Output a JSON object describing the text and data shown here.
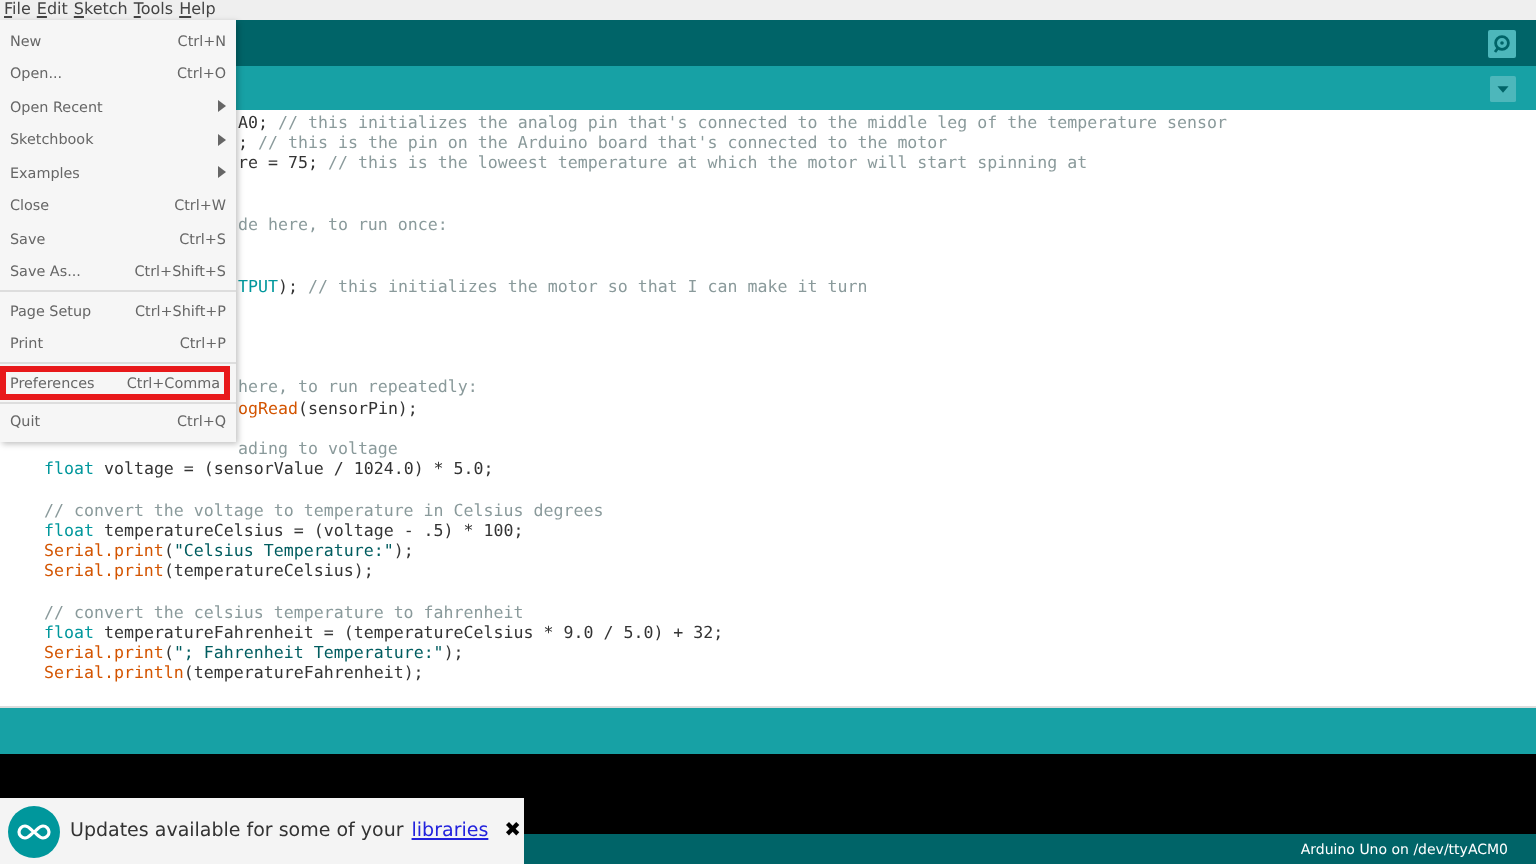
{
  "menubar": [
    "File",
    "Edit",
    "Sketch",
    "Tools",
    "Help"
  ],
  "editor": {
    "lines": [
      {
        "kind": "behind_menu",
        "segments": [
          {
            "text": "A0; ",
            "kind": "plain"
          },
          {
            "text": "// this initializes the analog pin that's connected to the middle leg of the temperature sensor",
            "kind": "comment"
          }
        ]
      },
      {
        "kind": "behind_menu",
        "segments": [
          {
            "text": "; ",
            "kind": "plain"
          },
          {
            "text": "// this is the pin on the Arduino board that's connected to the motor",
            "kind": "comment"
          }
        ]
      },
      {
        "kind": "behind_menu",
        "segments": [
          {
            "text": "re = 75; ",
            "kind": "plain"
          },
          {
            "text": "// this is the loweest temperature at which the motor will start spinning at",
            "kind": "comment"
          }
        ]
      },
      {
        "kind": "blank"
      },
      {
        "kind": "blank"
      },
      {
        "kind": "behind_menu",
        "segments": [
          {
            "text": "de here, to run once:",
            "kind": "comment"
          }
        ]
      },
      {
        "kind": "blank"
      },
      {
        "kind": "blank"
      },
      {
        "kind": "behind_menu",
        "segments": [
          {
            "text": "TPUT",
            "kind": "constant"
          },
          {
            "text": "); ",
            "kind": "plain"
          },
          {
            "text": "// this initializes the motor so that I can make it turn",
            "kind": "comment"
          }
        ]
      },
      {
        "kind": "blank"
      },
      {
        "kind": "blank"
      },
      {
        "kind": "blank"
      },
      {
        "kind": "blank"
      },
      {
        "kind": "behind_menu",
        "segments": [
          {
            "text": "here, to run repeatedly:",
            "kind": "comment"
          }
        ]
      },
      {
        "kind": "behind_menu",
        "segments": [
          {
            "text": "ogRead",
            "kind": "function"
          },
          {
            "text": "(sensorPin);",
            "kind": "plain"
          }
        ]
      },
      {
        "kind": "blank"
      },
      {
        "kind": "behind_menu",
        "segments": [
          {
            "text": "ading to voltage",
            "kind": "comment"
          }
        ]
      },
      {
        "kind": "code",
        "segments": [
          {
            "text": "float",
            "kind": "keyword"
          },
          {
            "text": " voltage = (sensorValue / 1024.0) * 5.0;",
            "kind": "plain"
          }
        ]
      },
      {
        "kind": "blank"
      },
      {
        "kind": "code",
        "segments": [
          {
            "text": "// convert the voltage to temperature in Celsius degrees",
            "kind": "comment"
          }
        ]
      },
      {
        "kind": "code",
        "segments": [
          {
            "text": "float",
            "kind": "keyword"
          },
          {
            "text": " temperatureCelsius = (voltage - .5) * 100;",
            "kind": "plain"
          }
        ]
      },
      {
        "kind": "code",
        "segments": [
          {
            "text": "Serial.print",
            "kind": "function"
          },
          {
            "text": "(",
            "kind": "plain"
          },
          {
            "text": "\"Celsius Temperature:\"",
            "kind": "string"
          },
          {
            "text": ");",
            "kind": "plain"
          }
        ]
      },
      {
        "kind": "code",
        "segments": [
          {
            "text": "Serial.print",
            "kind": "function"
          },
          {
            "text": "(temperatureCelsius);",
            "kind": "plain"
          }
        ]
      },
      {
        "kind": "blank"
      },
      {
        "kind": "code",
        "segments": [
          {
            "text": "// convert the celsius temperature to fahrenheit",
            "kind": "comment"
          }
        ]
      },
      {
        "kind": "code",
        "segments": [
          {
            "text": "float",
            "kind": "keyword"
          },
          {
            "text": " temperatureFahrenheit = (temperatureCelsius * 9.0 / 5.0) + 32;",
            "kind": "plain"
          }
        ]
      },
      {
        "kind": "code",
        "segments": [
          {
            "text": "Serial.print",
            "kind": "function"
          },
          {
            "text": "(",
            "kind": "plain"
          },
          {
            "text": "\"; Fahrenheit Temperature:\"",
            "kind": "string"
          },
          {
            "text": ");",
            "kind": "plain"
          }
        ]
      },
      {
        "kind": "code",
        "segments": [
          {
            "text": "Serial.println",
            "kind": "function"
          },
          {
            "text": "(temperatureFahrenheit);",
            "kind": "plain"
          }
        ]
      }
    ]
  },
  "file_menu": [
    {
      "kind": "item",
      "label": "New",
      "shortcut": "Ctrl+N",
      "highlighted": false
    },
    {
      "kind": "item",
      "label": "Open...",
      "shortcut": "Ctrl+O",
      "highlighted": false
    },
    {
      "kind": "submenu",
      "label": "Open Recent",
      "highlighted": false
    },
    {
      "kind": "submenu",
      "label": "Sketchbook",
      "highlighted": false
    },
    {
      "kind": "submenu",
      "label": "Examples",
      "highlighted": false
    },
    {
      "kind": "item",
      "label": "Close",
      "shortcut": "Ctrl+W",
      "highlighted": false
    },
    {
      "kind": "item",
      "label": "Save",
      "shortcut": "Ctrl+S",
      "highlighted": false
    },
    {
      "kind": "item",
      "label": "Save As...",
      "shortcut": "Ctrl+Shift+S",
      "highlighted": false
    },
    {
      "kind": "separator"
    },
    {
      "kind": "item",
      "label": "Page Setup",
      "shortcut": "Ctrl+Shift+P",
      "highlighted": false
    },
    {
      "kind": "item",
      "label": "Print",
      "shortcut": "Ctrl+P",
      "highlighted": false
    },
    {
      "kind": "separator"
    },
    {
      "kind": "item",
      "label": "Preferences",
      "shortcut": "Ctrl+Comma",
      "highlighted": true
    },
    {
      "kind": "separator"
    },
    {
      "kind": "item",
      "label": "Quit",
      "shortcut": "Ctrl+Q",
      "highlighted": false
    }
  ],
  "notification": {
    "message": "Updates available for some of your",
    "link": "libraries",
    "close": "✖"
  },
  "status_bar": {
    "board": "Arduino Uno on /dev/ttyACM0"
  }
}
